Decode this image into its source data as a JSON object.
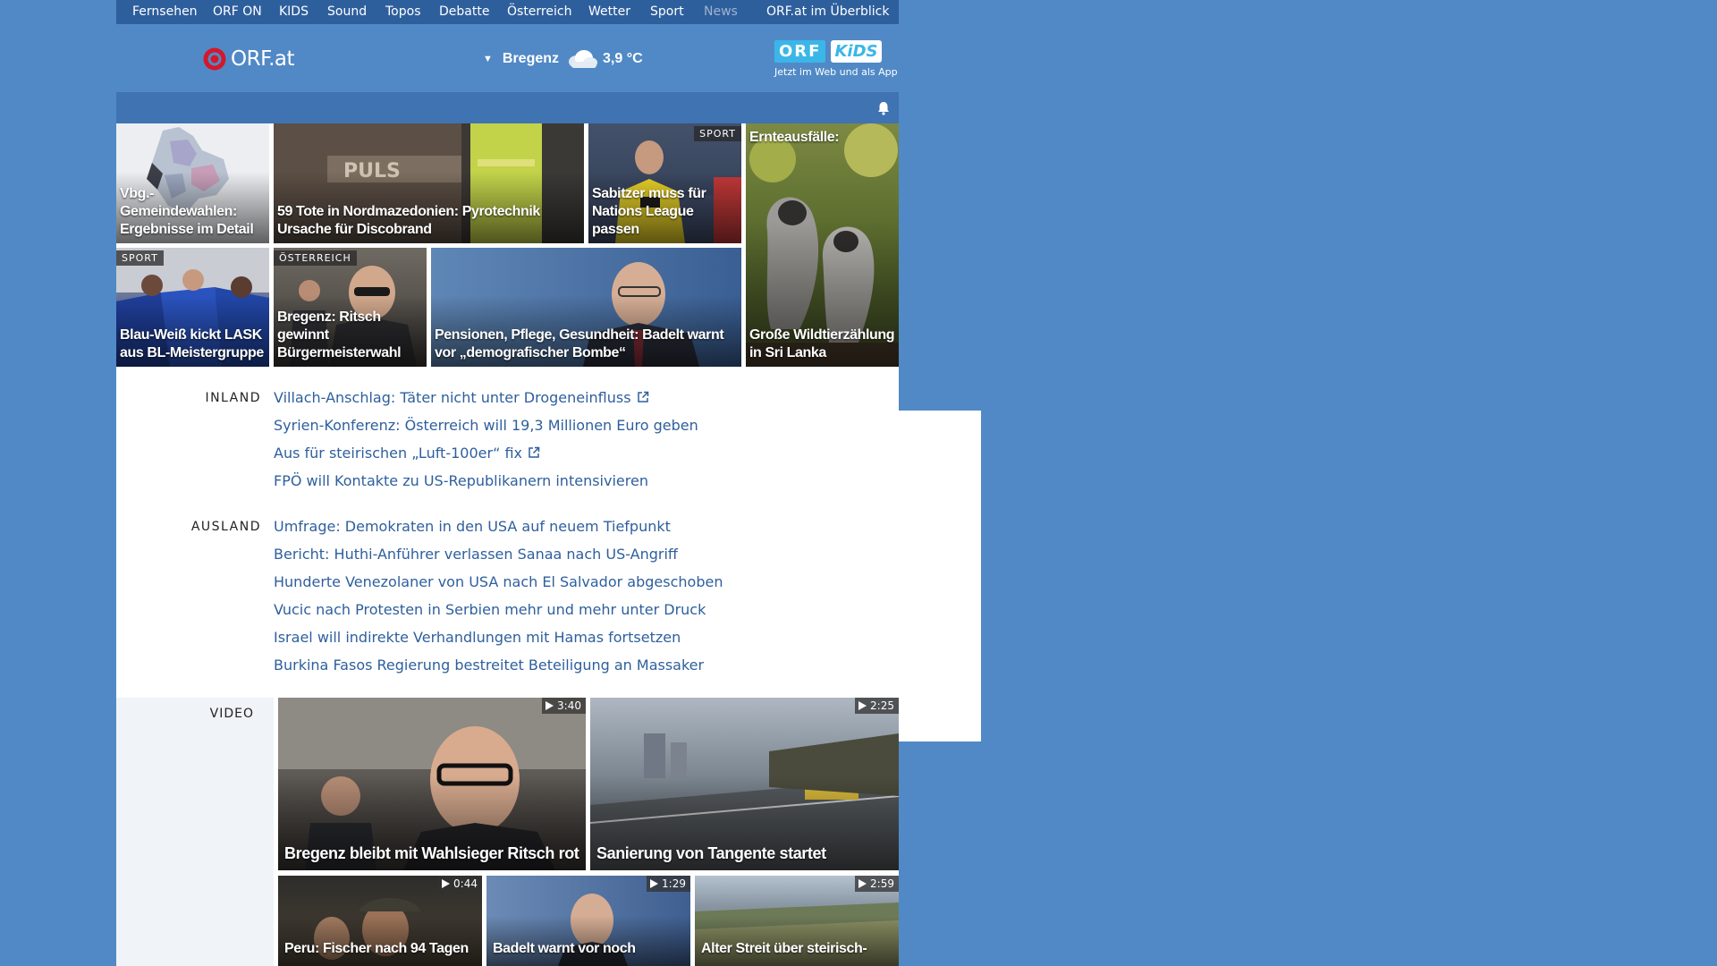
{
  "topnav": {
    "items": [
      "Fernsehen",
      "ORF ON",
      "KIDS",
      "Sound",
      "Topos",
      "Debatte",
      "Österreich",
      "Wetter",
      "Sport",
      "News"
    ],
    "overview": "ORF.at im Überblick"
  },
  "header": {
    "logo_news": "news",
    "logo_orf": "ORF.at",
    "weather_city": "Bregenz",
    "weather_temp": "3,9 °C",
    "kids_orf": "ORF",
    "kids_word": "KiDS",
    "kids_sub": "Jetzt im Web und als App"
  },
  "tiles": [
    {
      "caption": "Vbg.-Gemeindewahlen: Ergebnisse im Detail",
      "tag": ""
    },
    {
      "caption": "59 Tote in Nordmazedonien: Pyrotechnik Ursache für Discobrand",
      "tag": ""
    },
    {
      "caption": "Sabitzer muss für Nations League passen",
      "tag": "SPORT"
    },
    {
      "caption": "Ernteausfälle: Große Wildtierzählung in Sri Lanka",
      "caption_top": "Ernteausfälle:",
      "caption_bottom": "Große Wildtierzählung in Sri Lanka",
      "tag": ""
    },
    {
      "caption": "Blau-Weiß kickt LASK aus BL-Meistergruppe",
      "tag": "SPORT"
    },
    {
      "caption": "Bregenz: Ritsch gewinnt Bürgermeisterwahl",
      "tag": "ÖSTERREICH"
    },
    {
      "caption": "Pensionen, Pflege, Gesundheit: Badelt warnt vor „demografischer Bombe“",
      "tag": ""
    }
  ],
  "sections": {
    "inland": {
      "label": "INLAND",
      "headlines": [
        "Villach-Anschlag: Täter nicht unter Drogeneinfluss",
        "Syrien-Konferenz: Österreich will 19,3 Millionen Euro geben",
        "Aus für steirischen „Luft-100er“ fix",
        "FPÖ will Kontakte zu US-Republikanern intensivieren"
      ]
    },
    "ausland": {
      "label": "AUSLAND",
      "headlines": [
        "Umfrage: Demokraten in den USA auf neuem Tiefpunkt",
        "Bericht: Huthi-Anführer verlassen Sanaa nach US-Angriff",
        "Hunderte Venezolaner von USA nach El Salvador abgeschoben",
        "Vucic nach Protesten in Serbien mehr und mehr unter Druck",
        "Israel will indirekte Verhandlungen mit Hamas fortsetzen",
        "Burkina Fasos Regierung bestreitet Beteiligung an Massaker"
      ]
    }
  },
  "video": {
    "label": "VIDEO",
    "items": [
      {
        "caption": "Bregenz bleibt mit Wahlsieger Ritsch rot",
        "duration": "3:40"
      },
      {
        "caption": "Sanierung von Tangente startet",
        "duration": "2:25"
      },
      {
        "caption": "Peru: Fischer nach 94 Tagen",
        "duration": "0:44"
      },
      {
        "caption": "Badelt warnt vor noch",
        "duration": "1:29"
      },
      {
        "caption": "Alter Streit über steirisch-",
        "duration": "2:59"
      }
    ]
  },
  "colors": {
    "background": "#5189c6",
    "nav": "#2e5f9d",
    "link": "#2e5f9d",
    "news_red": "#d3182a",
    "kids_blue": "#3bb6e8"
  }
}
